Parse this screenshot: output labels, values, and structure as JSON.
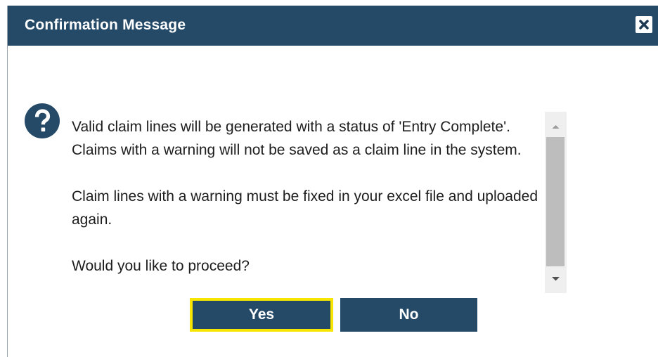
{
  "dialog": {
    "title": "Confirmation Message",
    "close_label": "×"
  },
  "message": {
    "paragraphs": [
      "Valid claim lines will be generated with a status of 'Entry Complete'. Claims with a warning will not be saved as a claim line in the system.",
      "Claim lines with a warning must be fixed in your excel file and uploaded again.",
      "Would you like to proceed?"
    ]
  },
  "buttons": {
    "yes_label": "Yes",
    "no_label": "No"
  },
  "icons": {
    "question": "question-circle-icon",
    "close": "close-icon",
    "scroll_up": "scroll-up-arrow-icon",
    "scroll_down": "scroll-down-arrow-icon"
  },
  "colors": {
    "header": "#254a68",
    "button": "#254a68",
    "focus_outline": "#f5e500",
    "scroll_track": "#efefef",
    "scroll_thumb": "#bdbdbd"
  }
}
